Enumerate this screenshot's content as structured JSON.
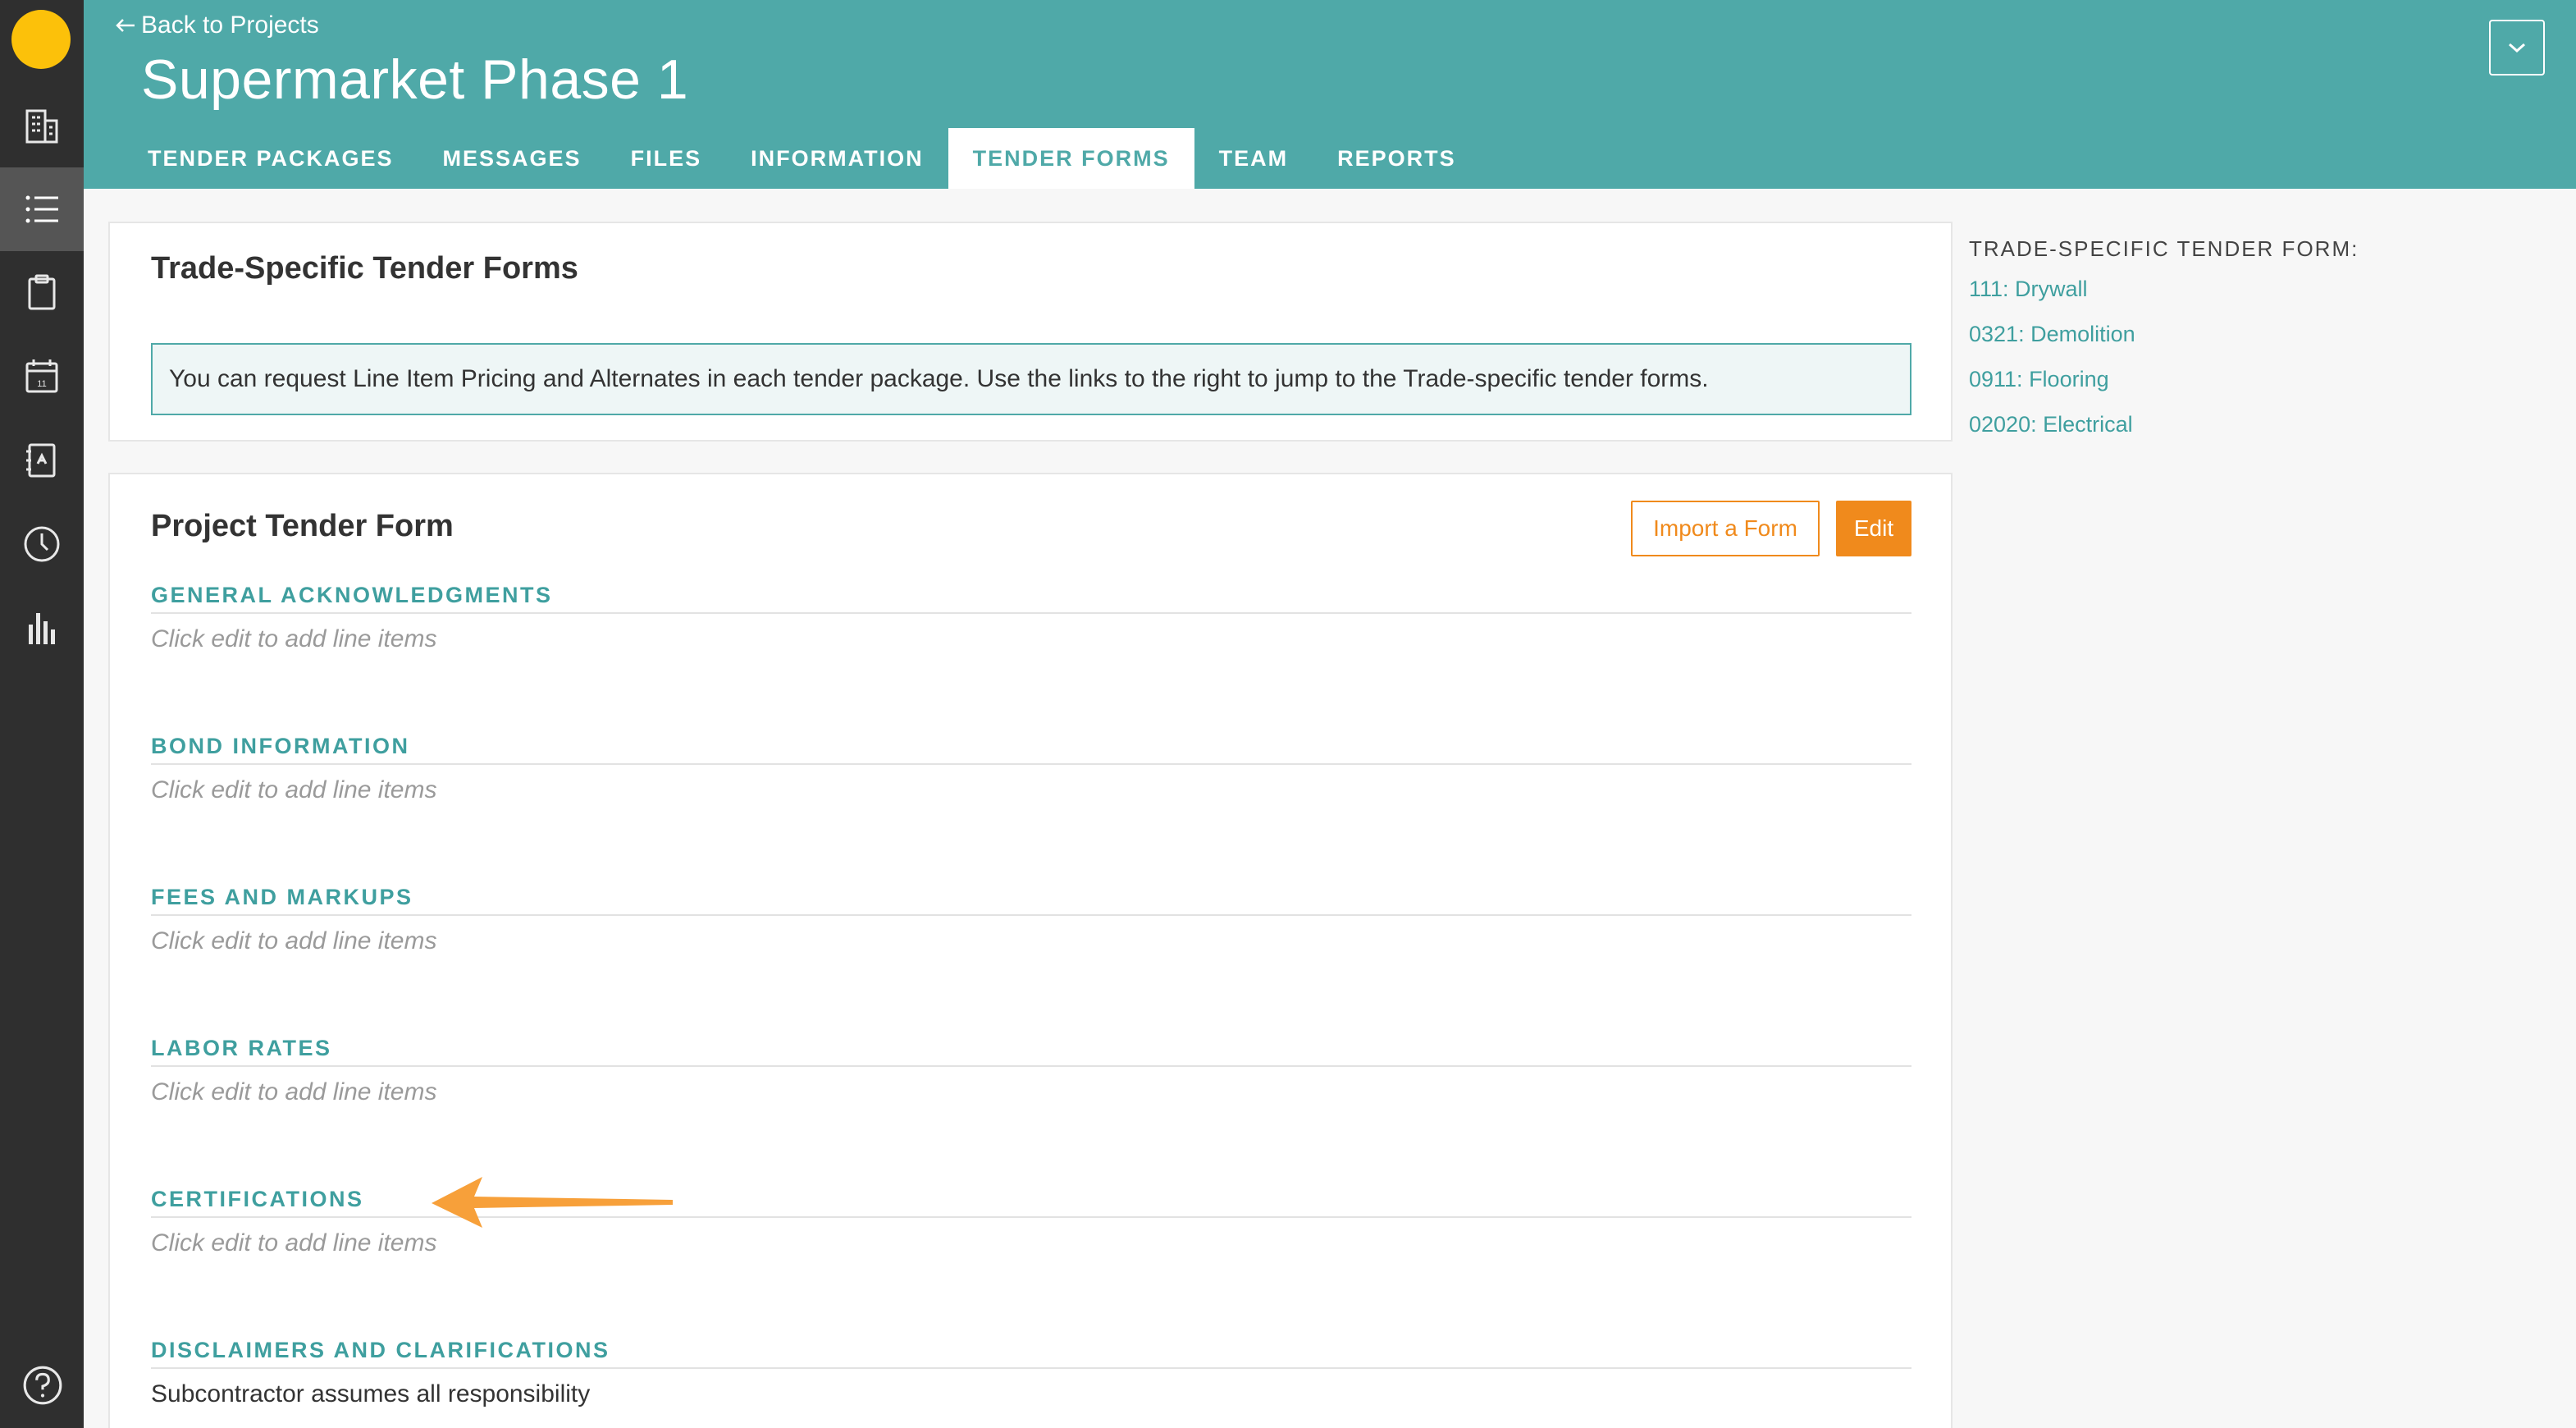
{
  "header": {
    "back_label": "Back to Projects",
    "project_title": "Supermarket Phase 1"
  },
  "tabs": [
    {
      "label": "TENDER PACKAGES",
      "active": false
    },
    {
      "label": "MESSAGES",
      "active": false
    },
    {
      "label": "FILES",
      "active": false
    },
    {
      "label": "INFORMATION",
      "active": false
    },
    {
      "label": "TENDER FORMS",
      "active": true
    },
    {
      "label": "TEAM",
      "active": false
    },
    {
      "label": "REPORTS",
      "active": false
    }
  ],
  "sidebar": {
    "icons": [
      "buildings-icon",
      "list-icon",
      "clipboard-icon",
      "calendar-icon",
      "address-book-icon",
      "clock-icon",
      "bar-chart-icon"
    ],
    "active_icon": "list-icon",
    "calendar_day": "11",
    "help_icon": "help-icon"
  },
  "trade_card": {
    "title": "Trade-Specific Tender Forms",
    "info": "You can request Line Item Pricing and Alternates in each tender package. Use the links to the right to jump to the Trade-specific tender forms."
  },
  "project_card": {
    "title": "Project Tender Form",
    "import_label": "Import a Form",
    "edit_label": "Edit",
    "sections": [
      {
        "heading": "GENERAL ACKNOWLEDGMENTS",
        "body": "Click edit to add line items",
        "placeholder": true
      },
      {
        "heading": "BOND INFORMATION",
        "body": "Click edit to add line items",
        "placeholder": true
      },
      {
        "heading": "FEES AND MARKUPS",
        "body": "Click edit to add line items",
        "placeholder": true
      },
      {
        "heading": "LABOR RATES",
        "body": "Click edit to add line items",
        "placeholder": true
      },
      {
        "heading": "CERTIFICATIONS",
        "body": "Click edit to add line items",
        "placeholder": true
      },
      {
        "heading": "DISCLAIMERS AND CLARIFICATIONS",
        "body": "Subcontractor assumes all responsibility",
        "placeholder": false
      }
    ]
  },
  "side_panel": {
    "heading": "TRADE-SPECIFIC TENDER FORM:",
    "links": [
      "111: Drywall",
      "0321: Demolition",
      "0911: Flooring",
      "02020: Electrical"
    ]
  },
  "colors": {
    "teal": "#4fa9a8",
    "orange": "#f08a1c",
    "rail": "#2f2f2f",
    "logo": "#fcc10a"
  }
}
